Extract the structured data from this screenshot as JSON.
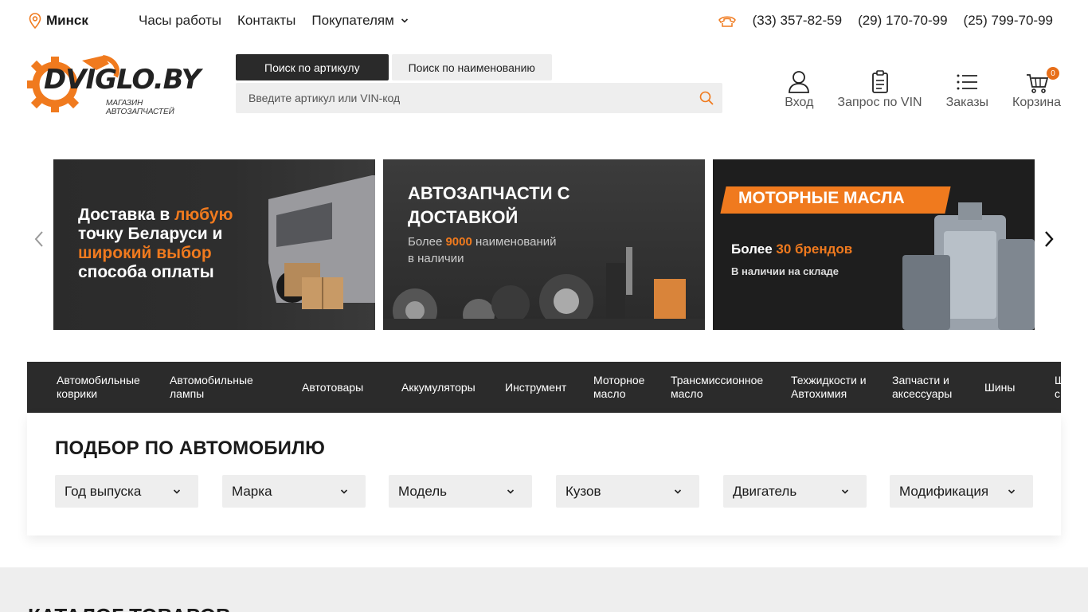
{
  "topbar": {
    "city": "Минск",
    "nav": [
      "Часы работы",
      "Контакты",
      "Покупателям"
    ],
    "phones": [
      "(33) 357-82-59",
      "(29) 170-70-99",
      "(25) 799-70-99"
    ]
  },
  "logo": {
    "text": "DVIGLO.BY",
    "subtitle": "МАГАЗИН АВТОЗАПЧАСТЕЙ"
  },
  "search": {
    "tabs": [
      "Поиск по артикулу",
      "Поиск по наименованию"
    ],
    "active_tab": 0,
    "placeholder": "Введите артикул или VIN-код"
  },
  "header_actions": {
    "login": "Вход",
    "vin": "Запрос по VIN",
    "orders": "Заказы",
    "cart": "Корзина",
    "cart_count": "0"
  },
  "banners": [
    {
      "line1a": "Доставка в ",
      "line1b": "любую",
      "line2": "точку Беларуси и",
      "line3": "широкий выбор",
      "line4": "способа оплаты"
    },
    {
      "title1": "АВТОЗАПЧАСТИ С",
      "title2": "ДОСТАВКОЙ",
      "sub1a": "Более ",
      "sub1b": "9000",
      "sub1c": " наименований",
      "sub2": "в наличии"
    },
    {
      "title": "МОТОРНЫЕ МАСЛА",
      "sub1a": "Более ",
      "sub1b": "30 брендов",
      "sub2": "В наличии на складе"
    }
  ],
  "categories": [
    "Автомобильные коврики",
    "Автомобильные лампы",
    "Автотовары",
    "Аккумуляторы",
    "Инструмент",
    "Моторное масло",
    "Трансмиссионное масло",
    "Техжидкости и Автохимия",
    "Запчасти и аксессуары",
    "Шины",
    "Ш с"
  ],
  "car_picker": {
    "title": "ПОДБОР ПО АВТОМОБИЛЮ",
    "selects": [
      "Год выпуска",
      "Марка",
      "Модель",
      "Кузов",
      "Двигатель",
      "Модификация"
    ]
  },
  "catalog": {
    "title": "КАТАЛОГ ТОВАРОВ"
  },
  "colors": {
    "accent": "#f07a1e",
    "dark": "#2b2b2b",
    "light_gray": "#eeeeee"
  }
}
